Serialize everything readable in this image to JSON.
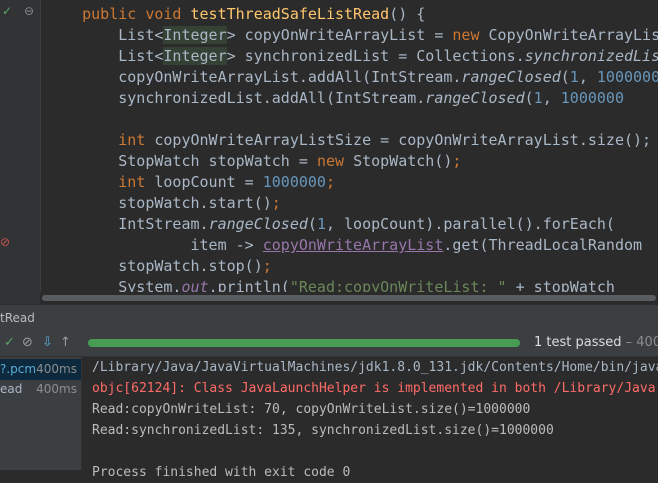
{
  "editor": {
    "gutter": {
      "run_icon": "✓",
      "bookmark_icon": "⊖",
      "breakpoint_icon": "⊘"
    },
    "lines": [
      {
        "indent": "    ",
        "parts": [
          {
            "t": "public ",
            "c": "kw"
          },
          {
            "t": "void ",
            "c": "kw"
          },
          {
            "t": "testThreadSafeListRead",
            "c": "mth"
          },
          {
            "t": "() {",
            "c": ""
          }
        ]
      },
      {
        "indent": "        ",
        "parts": [
          {
            "t": "List<",
            "c": ""
          },
          {
            "t": "Integer",
            "c": "gen"
          },
          {
            "t": "> copyOnWriteArrayList = ",
            "c": ""
          },
          {
            "t": "new ",
            "c": "kw"
          },
          {
            "t": "CopyOnWriteArrayList<>",
            "c": ""
          }
        ]
      },
      {
        "indent": "        ",
        "parts": [
          {
            "t": "List<",
            "c": ""
          },
          {
            "t": "Integer",
            "c": "gen"
          },
          {
            "t": "> synchronizedList = Collections.",
            "c": ""
          },
          {
            "t": "synchronizedList",
            "c": "itl"
          }
        ]
      },
      {
        "indent": "        ",
        "parts": [
          {
            "t": "copyOnWriteArrayList.addAll(IntStream.",
            "c": ""
          },
          {
            "t": "rangeClosed",
            "c": "itl"
          },
          {
            "t": "(",
            "c": ""
          },
          {
            "t": "1",
            "c": "num"
          },
          {
            "t": ", ",
            "c": ""
          },
          {
            "t": "1000000",
            "c": "num"
          }
        ]
      },
      {
        "indent": "        ",
        "parts": [
          {
            "t": "synchronizedList.addAll(IntStream.",
            "c": ""
          },
          {
            "t": "rangeClosed",
            "c": "itl"
          },
          {
            "t": "(",
            "c": ""
          },
          {
            "t": "1",
            "c": "num"
          },
          {
            "t": ", ",
            "c": ""
          },
          {
            "t": "1000000",
            "c": "num"
          }
        ]
      },
      {
        "indent": "",
        "parts": []
      },
      {
        "indent": "        ",
        "parts": [
          {
            "t": "int ",
            "c": "kw"
          },
          {
            "t": "copyOnWriteArrayListSize = copyOnWriteArrayList.size();",
            "c": ""
          }
        ]
      },
      {
        "indent": "        ",
        "parts": [
          {
            "t": "StopWatch stopWatch = ",
            "c": ""
          },
          {
            "t": "new ",
            "c": "kw"
          },
          {
            "t": "StopWatch()",
            "c": ""
          },
          {
            "t": ";",
            "c": "kw"
          }
        ]
      },
      {
        "indent": "        ",
        "parts": [
          {
            "t": "int ",
            "c": "kw"
          },
          {
            "t": "loopCount = ",
            "c": ""
          },
          {
            "t": "1000000",
            "c": "num"
          },
          {
            "t": ";",
            "c": "kw"
          }
        ]
      },
      {
        "indent": "        ",
        "parts": [
          {
            "t": "stopWatch.start()",
            "c": ""
          },
          {
            "t": ";",
            "c": "kw"
          }
        ]
      },
      {
        "indent": "        ",
        "parts": [
          {
            "t": "IntStream.",
            "c": ""
          },
          {
            "t": "rangeClosed",
            "c": "itl"
          },
          {
            "t": "(",
            "c": ""
          },
          {
            "t": "1",
            "c": "num"
          },
          {
            "t": ", ",
            "c": ""
          },
          {
            "t": "loopCount).parallel().forEach(",
            "c": ""
          }
        ]
      },
      {
        "indent": "                ",
        "parts": [
          {
            "t": "item -> ",
            "c": ""
          },
          {
            "t": "copyOnWriteArrayList",
            "c": "link"
          },
          {
            "t": ".get(ThreadLocalRandom",
            "c": ""
          }
        ]
      },
      {
        "indent": "        ",
        "parts": [
          {
            "t": "stopWatch.stop()",
            "c": ""
          },
          {
            "t": ";",
            "c": "kw"
          }
        ]
      },
      {
        "indent": "        ",
        "parts": [
          {
            "t": "System.",
            "c": ""
          },
          {
            "t": "out",
            "c": "stat"
          },
          {
            "t": ".println(",
            "c": ""
          },
          {
            "t": "\"Read:copyOnWriteList: \"",
            "c": "str"
          },
          {
            "t": " + stopWatch",
            "c": ""
          }
        ]
      }
    ]
  },
  "run_panel": {
    "title": "tRead",
    "test_status": "1 test passed",
    "test_duration": " – 400",
    "progress_fraction": 1.0
  },
  "toolbar_icons": {
    "check": "✓",
    "stop": "⊘",
    "sort_up": "↑",
    "sort_down": "↓",
    "export": "⇩",
    "expand": "⊞",
    "collapse": "⊟"
  },
  "tests": [
    {
      "name": "?.pcm",
      "time": "400ms"
    },
    {
      "name": "ead",
      "time": "400ms"
    }
  ],
  "console": [
    {
      "text": "/Library/Java/JavaVirtualMachines/jdk1.8.0_131.jdk/Contents/Home/bin/java",
      "kind": "dim"
    },
    {
      "text": "objc[62124]: Class JavaLaunchHelper is implemented in both /Library/Java",
      "kind": "err"
    },
    {
      "text": "Read:copyOnWriteList: 70, copyOnWriteList.size()=1000000",
      "kind": ""
    },
    {
      "text": "Read:synchronizedList: 135, synchronizedList.size()=1000000",
      "kind": ""
    },
    {
      "text": "",
      "kind": ""
    },
    {
      "text": "Process finished with exit code 0",
      "kind": ""
    }
  ]
}
